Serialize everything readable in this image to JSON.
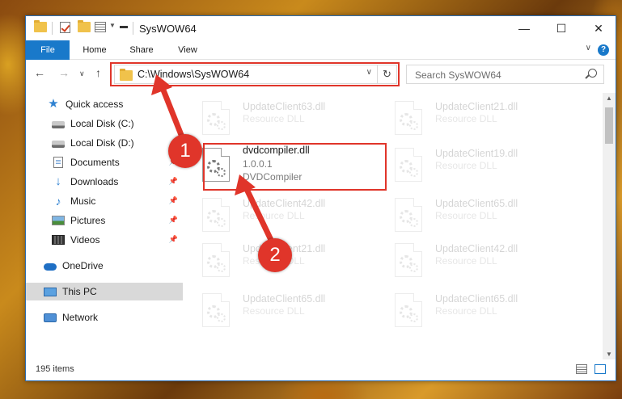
{
  "window": {
    "title": "SysWOW64",
    "minimize": "—",
    "maximize": "☐",
    "close": "✕"
  },
  "ribbon": {
    "tabs": [
      "File",
      "Home",
      "Share",
      "View"
    ],
    "help": "?"
  },
  "address": {
    "path": "C:\\Windows\\SysWOW64",
    "search_placeholder": "Search SysWOW64"
  },
  "sidebar": {
    "items": [
      {
        "label": "Quick access",
        "icon": "star-icon"
      },
      {
        "label": "Local Disk (C:)",
        "icon": "disk-icon"
      },
      {
        "label": "Local Disk (D:)",
        "icon": "disk-icon"
      },
      {
        "label": "Documents",
        "icon": "document-icon"
      },
      {
        "label": "Downloads",
        "icon": "download-icon"
      },
      {
        "label": "Music",
        "icon": "music-icon"
      },
      {
        "label": "Pictures",
        "icon": "pictures-icon"
      },
      {
        "label": "Videos",
        "icon": "video-icon"
      },
      {
        "label": "OneDrive",
        "icon": "cloud-icon"
      },
      {
        "label": "This PC",
        "icon": "computer-icon",
        "selected": true
      },
      {
        "label": "Network",
        "icon": "network-icon"
      }
    ]
  },
  "files": [
    {
      "name": "UpdateClient63.dll",
      "type": "Resource DLL"
    },
    {
      "name": "UpdateClient21.dll",
      "type": "Resource DLL"
    },
    {
      "name": "dvdcompiler.dll",
      "version": "1.0.0.1",
      "type": "DVDCompiler"
    },
    {
      "name": "UpdateClient19.dll",
      "type": "Resource DLL"
    },
    {
      "name": "UpdateClient42.dll",
      "type": "Resource DLL"
    },
    {
      "name": "UpdateClient65.dll",
      "type": "Resource DLL"
    },
    {
      "name": "UpdateClient21.dll",
      "type": "Resource DLL"
    },
    {
      "name": "UpdateClient42.dll",
      "type": "Resource DLL"
    },
    {
      "name": "UpdateClient65.dll",
      "type": "Resource DLL"
    },
    {
      "name": "UpdateClient65.dll",
      "type": "Resource DLL"
    }
  ],
  "status": {
    "count": "195 items"
  },
  "annotations": {
    "step1": "1",
    "step2": "2",
    "color": "#e0352a"
  }
}
